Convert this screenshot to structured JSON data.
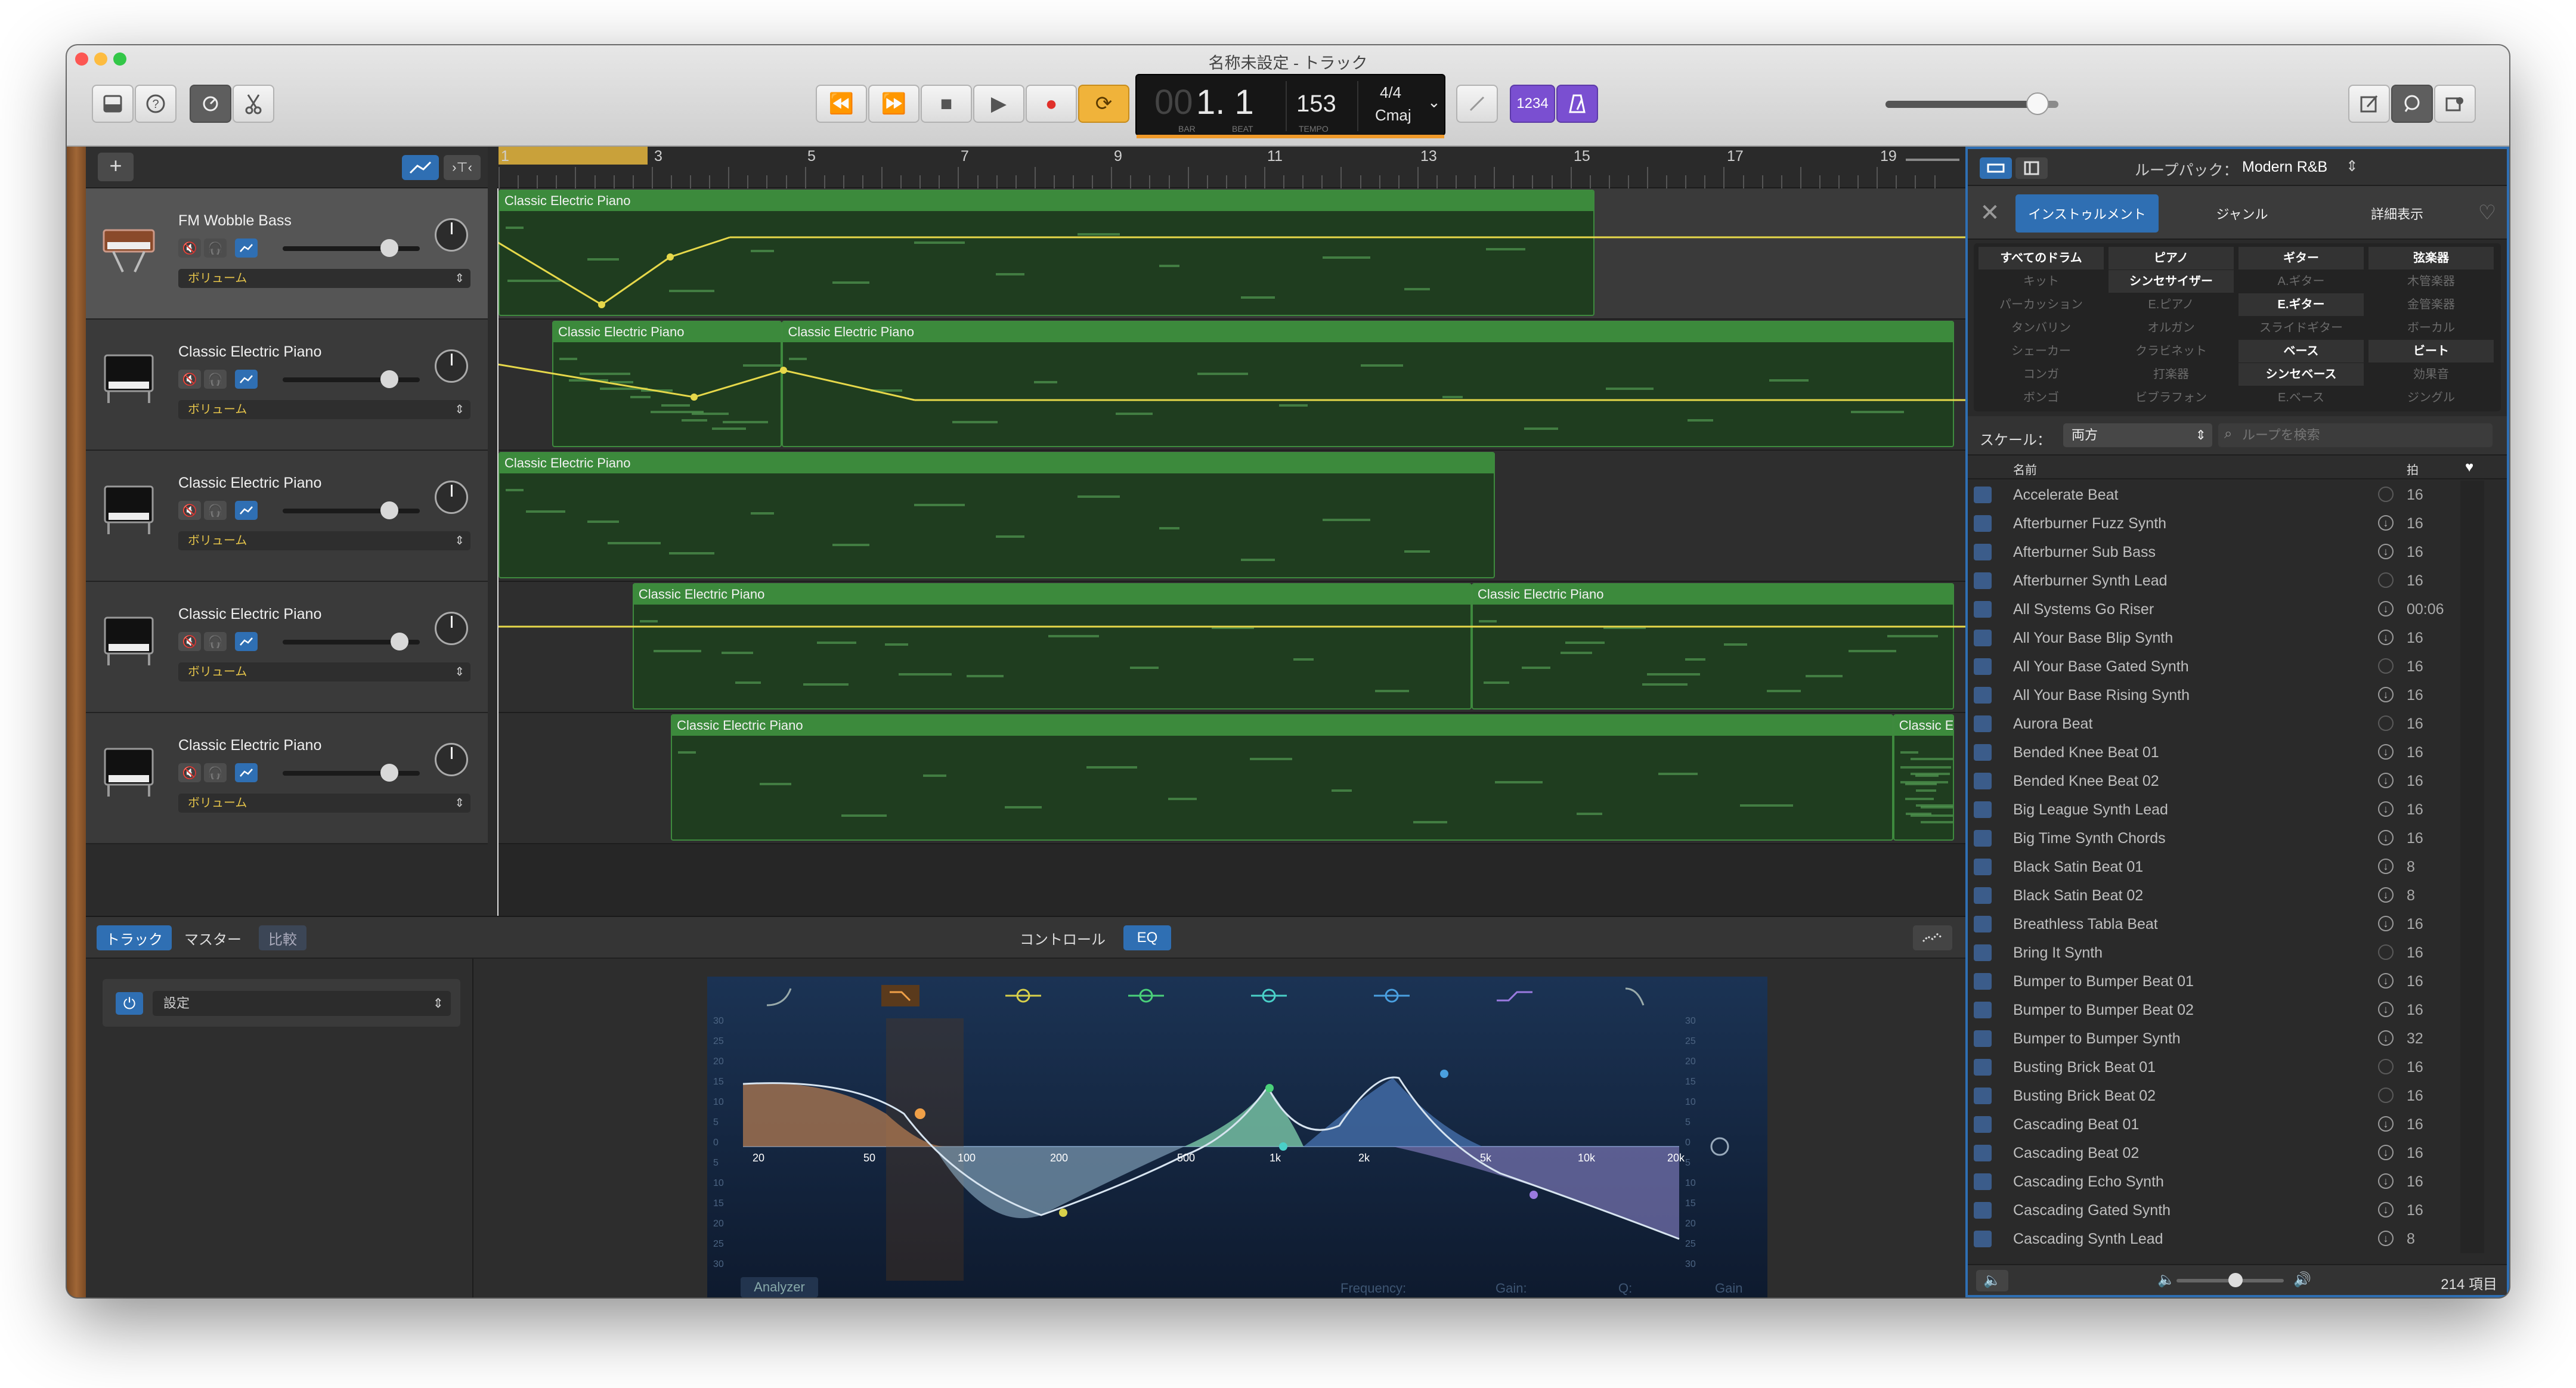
{
  "window": {
    "title": "名称未設定 - トラック"
  },
  "toolbar": {
    "library_icon": "library-icon",
    "help_icon": "help-icon",
    "smart_controls_icon": "smart-controls-icon",
    "editors_icon": "scissors-icon",
    "rewind": "⏪",
    "forward": "⏩",
    "stop": "■",
    "play": "▶",
    "record": "●",
    "cycle": "⟳",
    "lcd": {
      "bar_beat": "1. 1",
      "bar_prefix": "00",
      "bar_label": "BAR",
      "beat_label": "BEAT",
      "tempo": "153",
      "tempo_label": "TEMPO",
      "time_sig": "4/4",
      "key": "Cmaj"
    },
    "count_in": "1234",
    "metronome_icon": "metronome-icon",
    "master_volume_value": 0.88,
    "notepad_icon": "notepad-icon",
    "loop_browser_icon": "loop-icon",
    "media_browser_icon": "media-icon"
  },
  "tracks": [
    {
      "name": "FM Wobble Bass",
      "automation": "ボリューム",
      "volume": 0.78,
      "selected": true
    },
    {
      "name": "Classic Electric Piano",
      "automation": "ボリューム",
      "volume": 0.78,
      "selected": false
    },
    {
      "name": "Classic Electric Piano",
      "automation": "ボリューム",
      "volume": 0.78,
      "selected": false
    },
    {
      "name": "Classic Electric Piano",
      "automation": "ボリューム",
      "volume": 0.85,
      "selected": false
    },
    {
      "name": "Classic Electric Piano",
      "automation": "ボリューム",
      "volume": 0.78,
      "selected": false
    }
  ],
  "ruler": {
    "bars": [
      "1",
      "3",
      "5",
      "7",
      "9",
      "11",
      "13",
      "15",
      "17",
      "19"
    ]
  },
  "regions": [
    {
      "lane": 0,
      "name": "Classic Electric Piano",
      "start": 1,
      "end": 15.3
    },
    {
      "lane": 1,
      "name": "Classic Electric Piano",
      "start": 1.7,
      "end": 4.7
    },
    {
      "lane": 1,
      "name": "Classic Electric Piano",
      "start": 4.7,
      "end": 20
    },
    {
      "lane": 2,
      "name": "Classic Electric Piano",
      "start": 1,
      "end": 14
    },
    {
      "lane": 3,
      "name": "Classic Electric Piano",
      "start": 2.75,
      "end": 13.7
    },
    {
      "lane": 3,
      "name": "Classic Electric Piano",
      "start": 13.7,
      "end": 20
    },
    {
      "lane": 4,
      "name": "Classic Electric Piano",
      "start": 3.25,
      "end": 19.2
    },
    {
      "lane": 4,
      "name": "Classic Ele",
      "start": 19.2,
      "end": 20
    }
  ],
  "editor": {
    "tabs": [
      "トラック",
      "マスター",
      "比較"
    ],
    "center_tabs": [
      "コントロール",
      "EQ"
    ],
    "setting_label": "設定",
    "eq": {
      "freq_labels": [
        "20",
        "50",
        "100",
        "200",
        "500",
        "1k",
        "2k",
        "5k",
        "10k",
        "20k"
      ],
      "db_labels_left": [
        "30",
        "25",
        "20",
        "15",
        "10",
        "5",
        "0",
        "5",
        "10",
        "15",
        "20",
        "25",
        "30"
      ],
      "db_labels_right": [
        "30",
        "25",
        "20",
        "15",
        "10",
        "5",
        "0",
        "5",
        "10",
        "15",
        "20",
        "25",
        "30"
      ],
      "analyzer": "Analyzer",
      "frequency": "Frequency:",
      "gain": "Gain:",
      "q": "Q:",
      "gain_right": "Gain"
    }
  },
  "loop_browser": {
    "pack_label": "ループパック：",
    "pack_value": "Modern R&B",
    "tabs": [
      "インストゥルメント",
      "ジャンル",
      "詳細表示"
    ],
    "keywords": [
      [
        "すべてのドラム",
        "ピアノ",
        "ギター",
        "弦楽器"
      ],
      [
        "キット",
        "シンセサイザー",
        "A.ギター",
        "木管楽器"
      ],
      [
        "パーカッション",
        "E.ピアノ",
        "E.ギター",
        "金管楽器"
      ],
      [
        "タンバリン",
        "オルガン",
        "スライドギター",
        "ボーカル"
      ],
      [
        "シェーカー",
        "クラビネット",
        "ベース",
        "ビート"
      ],
      [
        "コンガ",
        "打楽器",
        "シンセベース",
        "効果音"
      ],
      [
        "ボンゴ",
        "ビブラフォン",
        "E.ベース",
        "ジングル"
      ]
    ],
    "keywords_active": [
      [
        true,
        true,
        true,
        true
      ],
      [
        false,
        true,
        false,
        false
      ],
      [
        false,
        false,
        true,
        false
      ],
      [
        false,
        false,
        false,
        false
      ],
      [
        false,
        false,
        true,
        true
      ],
      [
        false,
        false,
        true,
        false
      ],
      [
        false,
        false,
        false,
        false
      ]
    ],
    "scale_label": "スケール：",
    "scale_value": "両方",
    "search_placeholder": "ループを検索",
    "col_name": "名前",
    "col_beats": "拍",
    "loops": [
      {
        "name": "Accelerate Beat",
        "beats": "16",
        "dl": false
      },
      {
        "name": "Afterburner Fuzz Synth",
        "beats": "16",
        "dl": true
      },
      {
        "name": "Afterburner Sub Bass",
        "beats": "16",
        "dl": true
      },
      {
        "name": "Afterburner Synth Lead",
        "beats": "16",
        "dl": false
      },
      {
        "name": "All Systems Go Riser",
        "beats": "00:06",
        "dl": true
      },
      {
        "name": "All Your Base Blip Synth",
        "beats": "16",
        "dl": true
      },
      {
        "name": "All Your Base Gated Synth",
        "beats": "16",
        "dl": false
      },
      {
        "name": "All Your Base Rising Synth",
        "beats": "16",
        "dl": true
      },
      {
        "name": "Aurora Beat",
        "beats": "16",
        "dl": false
      },
      {
        "name": "Bended Knee Beat 01",
        "beats": "16",
        "dl": true
      },
      {
        "name": "Bended Knee Beat 02",
        "beats": "16",
        "dl": true
      },
      {
        "name": "Big League Synth Lead",
        "beats": "16",
        "dl": true
      },
      {
        "name": "Big Time Synth Chords",
        "beats": "16",
        "dl": true
      },
      {
        "name": "Black Satin Beat 01",
        "beats": "8",
        "dl": true
      },
      {
        "name": "Black Satin Beat 02",
        "beats": "8",
        "dl": true
      },
      {
        "name": "Breathless Tabla Beat",
        "beats": "16",
        "dl": true
      },
      {
        "name": "Bring It Synth",
        "beats": "16",
        "dl": false
      },
      {
        "name": "Bumper to Bumper Beat 01",
        "beats": "16",
        "dl": true
      },
      {
        "name": "Bumper to Bumper Beat 02",
        "beats": "16",
        "dl": true
      },
      {
        "name": "Bumper to Bumper Synth",
        "beats": "32",
        "dl": true
      },
      {
        "name": "Busting Brick Beat 01",
        "beats": "16",
        "dl": false
      },
      {
        "name": "Busting Brick Beat 02",
        "beats": "16",
        "dl": false
      },
      {
        "name": "Cascading Beat 01",
        "beats": "16",
        "dl": true
      },
      {
        "name": "Cascading Beat 02",
        "beats": "16",
        "dl": true
      },
      {
        "name": "Cascading Echo Synth",
        "beats": "16",
        "dl": true
      },
      {
        "name": "Cascading Gated Synth",
        "beats": "16",
        "dl": true
      },
      {
        "name": "Cascading Synth Lead",
        "beats": "8",
        "dl": true
      }
    ],
    "item_count": "214 項目",
    "preview_volume": 0.55
  },
  "colors": {
    "accent": "#2f6fb3",
    "region_header": "#3c8a3c",
    "region_body": "#1f3d1f",
    "automation": "#e6d84a",
    "cycle": "#c9a13a"
  }
}
